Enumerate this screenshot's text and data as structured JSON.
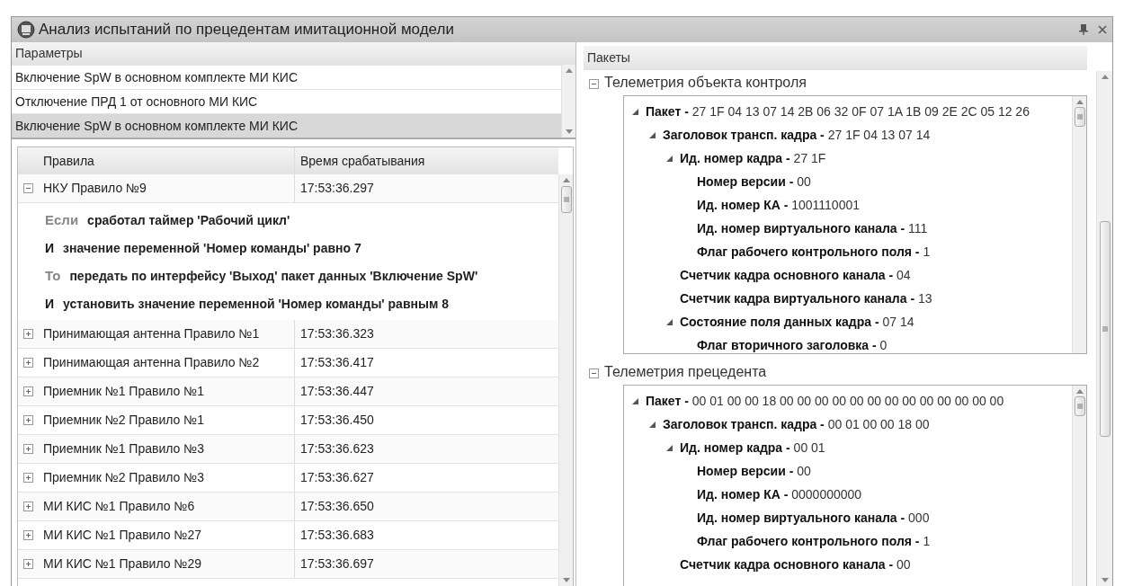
{
  "window": {
    "title": "Анализ испытаний по прецедентам имитационной модели"
  },
  "parameters": {
    "header": "Параметры",
    "items": [
      {
        "text": "Включение SpW в основном комплекте МИ КИС",
        "selected": false
      },
      {
        "text": "Отключение ПРД 1 от основного МИ КИС",
        "selected": false
      },
      {
        "text": "Включение SpW в основном комплекте МИ КИС",
        "selected": true
      }
    ]
  },
  "rules": {
    "columns": [
      "Правила",
      "Время срабатывания"
    ],
    "rows": [
      {
        "name": "НКУ Правило №9",
        "time": "17:53:36.297",
        "expanded": true,
        "details": [
          {
            "kind": "condition",
            "keyword": "Если",
            "text": "сработал таймер 'Рабочий цикл'"
          },
          {
            "kind": "and",
            "keyword": "И",
            "text": "значение переменной 'Номер команды' равно 7"
          },
          {
            "kind": "condition",
            "keyword": "То",
            "text": "передать по интерфейсу 'Выход' пакет данных 'Включение SpW'"
          },
          {
            "kind": "and",
            "keyword": "И",
            "text": "установить значение переменной 'Номер команды' равным 8"
          }
        ]
      },
      {
        "name": "Принимающая антенна Правило №1",
        "time": "17:53:36.323",
        "expanded": false
      },
      {
        "name": "Принимающая антенна Правило №2",
        "time": "17:53:36.417",
        "expanded": false
      },
      {
        "name": "Приемник №1 Правило №1",
        "time": "17:53:36.447",
        "expanded": false
      },
      {
        "name": "Приемник №2 Правило №1",
        "time": "17:53:36.450",
        "expanded": false
      },
      {
        "name": "Приемник №1 Правило №3",
        "time": "17:53:36.623",
        "expanded": false
      },
      {
        "name": "Приемник №2 Правило №3",
        "time": "17:53:36.627",
        "expanded": false
      },
      {
        "name": "МИ КИС №1 Правило №6",
        "time": "17:53:36.650",
        "expanded": false
      },
      {
        "name": "МИ КИС №1 Правило №27",
        "time": "17:53:36.683",
        "expanded": false
      },
      {
        "name": "МИ КИС №1 Правило №29",
        "time": "17:53:36.697",
        "expanded": false
      }
    ]
  },
  "packets": {
    "header": "Пакеты",
    "sections": [
      {
        "title": "Телеметрия объекта контроля",
        "expanded": true,
        "tree": [
          {
            "label": "Пакет -",
            "value": "27 1F 04 13 07 14 2B 06 32 0F 07 1A 1B 09 2E 2C 05 12 26",
            "expanded": true,
            "children": [
              {
                "label": "Заголовок трансп. кадра -",
                "value": "27 1F 04 13 07 14",
                "expanded": true,
                "children": [
                  {
                    "label": "Ид. номер кадра -",
                    "value": "27 1F",
                    "expanded": true,
                    "children": [
                      {
                        "label": "Номер версии -",
                        "value": "00"
                      },
                      {
                        "label": "Ид. номер КА -",
                        "value": "1001110001"
                      },
                      {
                        "label": "Ид. номер виртуального канала -",
                        "value": "111"
                      },
                      {
                        "label": "Флаг рабочего контрольного поля -",
                        "value": "1"
                      }
                    ]
                  },
                  {
                    "label": "Счетчик кадра основного канала -",
                    "value": "04"
                  },
                  {
                    "label": "Счетчик кадра виртуального канала -",
                    "value": "13"
                  },
                  {
                    "label": "Состояние поля данных кадра -",
                    "value": "07 14",
                    "expanded": true,
                    "children": [
                      {
                        "label": "Флаг вторичного заголовка -",
                        "value": "0"
                      }
                    ]
                  }
                ]
              }
            ]
          }
        ]
      },
      {
        "title": "Телеметрия прецедента",
        "expanded": true,
        "tree": [
          {
            "label": "Пакет -",
            "value": "00 01 00 00 18 00 00 00 00 00 00 00 00 00 00 00 00 00",
            "expanded": true,
            "children": [
              {
                "label": "Заголовок трансп. кадра -",
                "value": "00 01 00 00 18 00",
                "expanded": true,
                "children": [
                  {
                    "label": "Ид. номер кадра -",
                    "value": "00 01",
                    "expanded": true,
                    "children": [
                      {
                        "label": "Номер версии -",
                        "value": "00"
                      },
                      {
                        "label": "Ид. номер КА -",
                        "value": "0000000000"
                      },
                      {
                        "label": "Ид. номер виртуального канала -",
                        "value": "000"
                      },
                      {
                        "label": "Флаг рабочего контрольного поля -",
                        "value": "1"
                      }
                    ]
                  },
                  {
                    "label": "Счетчик кадра основного канала -",
                    "value": "00"
                  }
                ]
              }
            ]
          }
        ]
      }
    ]
  }
}
